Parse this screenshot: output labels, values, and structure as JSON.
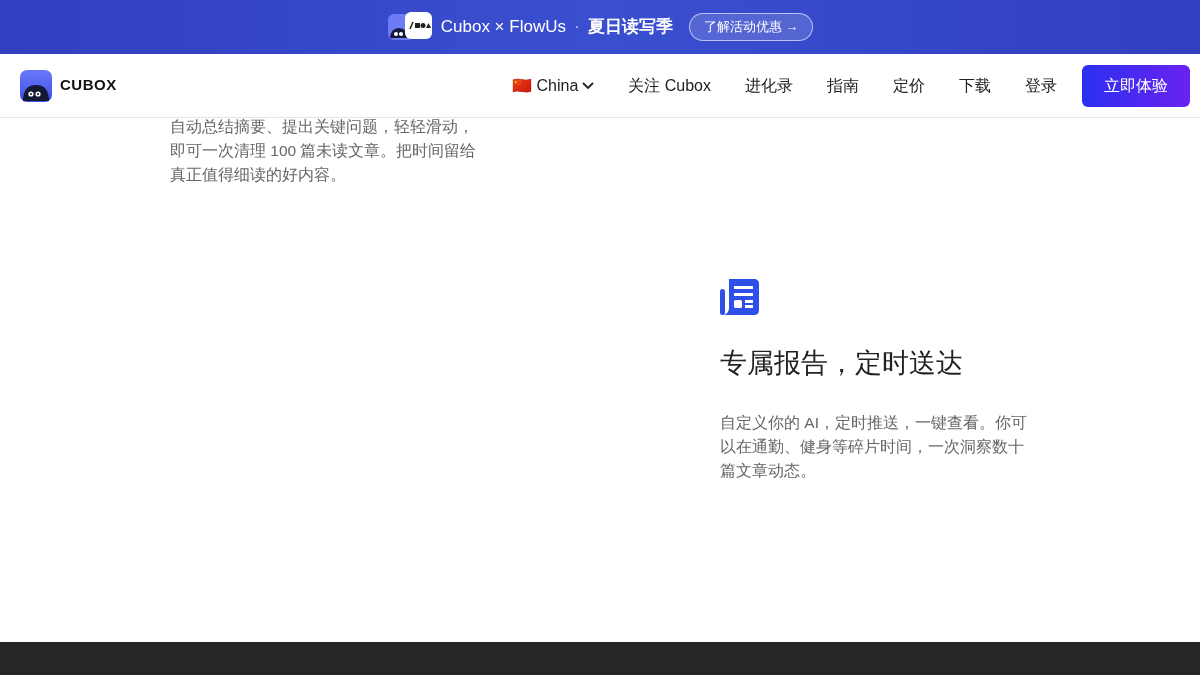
{
  "banner": {
    "title": "Cubox × FlowUs",
    "separator": "·",
    "subtitle": "夏日读写季",
    "button": "了解活动优惠 →"
  },
  "navbar": {
    "logo": "CUBOX",
    "language": {
      "flag": "🇨🇳",
      "label": "China"
    },
    "links": [
      "关注 Cubox",
      "进化录",
      "指南",
      "定价",
      "下载",
      "登录"
    ],
    "cta": "立即体验"
  },
  "features": [
    {
      "text": "自动总结摘要、提出关键问题，轻轻滑动，即可一次清理 100 篇未读文章。把时间留给真正值得细读的好内容。"
    },
    {
      "title": "专属报告，定时送达",
      "text": "自定义你的 AI，定时推送，一键查看。你可以在通勤、健身等碎片时间，一次洞察数十篇文章动态。"
    }
  ]
}
